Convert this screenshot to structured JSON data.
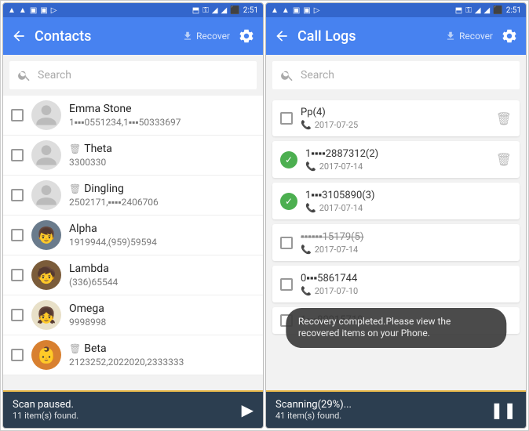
{
  "statusbar": {
    "time": "2:51"
  },
  "left": {
    "title": "Contacts",
    "recover": "Recover",
    "searchPlaceholder": "Search",
    "contacts": [
      {
        "name": "Emma Stone",
        "sub": "1▪▪▪0551234,1▪▪▪50333697",
        "deleted": false,
        "avatarType": "person"
      },
      {
        "name": "Theta",
        "sub": "3300330",
        "deleted": true,
        "avatarType": "person"
      },
      {
        "name": "Dingling",
        "sub": "2502171,▪▪▪▪2406706",
        "deleted": true,
        "avatarType": "person"
      },
      {
        "name": "Alpha",
        "sub": "1919944,(959)59594",
        "deleted": false,
        "avatarType": "alpha"
      },
      {
        "name": "Lambda",
        "sub": "(336)65544",
        "deleted": false,
        "avatarType": "lambda"
      },
      {
        "name": "Omega",
        "sub": "9998998",
        "deleted": false,
        "avatarType": "omega"
      },
      {
        "name": "Beta",
        "sub": "2123252,2022020,2333333",
        "deleted": true,
        "avatarType": "beta"
      }
    ],
    "bottom": {
      "title": "Scan paused.",
      "sub": "11 item(s) found."
    }
  },
  "right": {
    "title": "Call Logs",
    "recover": "Recover",
    "searchPlaceholder": "Search",
    "logs": [
      {
        "title": "Pp(4)",
        "date": "2017-07-25",
        "checked": false,
        "strike": false,
        "phone": "red",
        "trash": true
      },
      {
        "title": "1▪▪▪▪2887312(2)",
        "date": "2017-07-14",
        "checked": true,
        "strike": false,
        "phone": "green",
        "trash": true
      },
      {
        "title": "1▪▪▪3105890(3)",
        "date": "2017-07-14",
        "checked": true,
        "strike": false,
        "phone": "red",
        "trash": false
      },
      {
        "title": "▪▪▪▪▪▪15179(5)",
        "date": "2017-07-14",
        "checked": false,
        "strike": true,
        "phone": "red",
        "trash": false
      },
      {
        "title": "0▪▪▪5861744",
        "date": "2017-07-10",
        "checked": false,
        "strike": false,
        "phone": "red",
        "trash": false
      },
      {
        "title": "1▪▪▪80915719",
        "date": "",
        "checked": false,
        "strike": false,
        "phone": "",
        "trash": false
      }
    ],
    "toast": "Recovery completed.Please view the recovered items on your Phone.",
    "bottom": {
      "title": "Scanning(29%)...",
      "sub": "41 item(s) found."
    }
  }
}
